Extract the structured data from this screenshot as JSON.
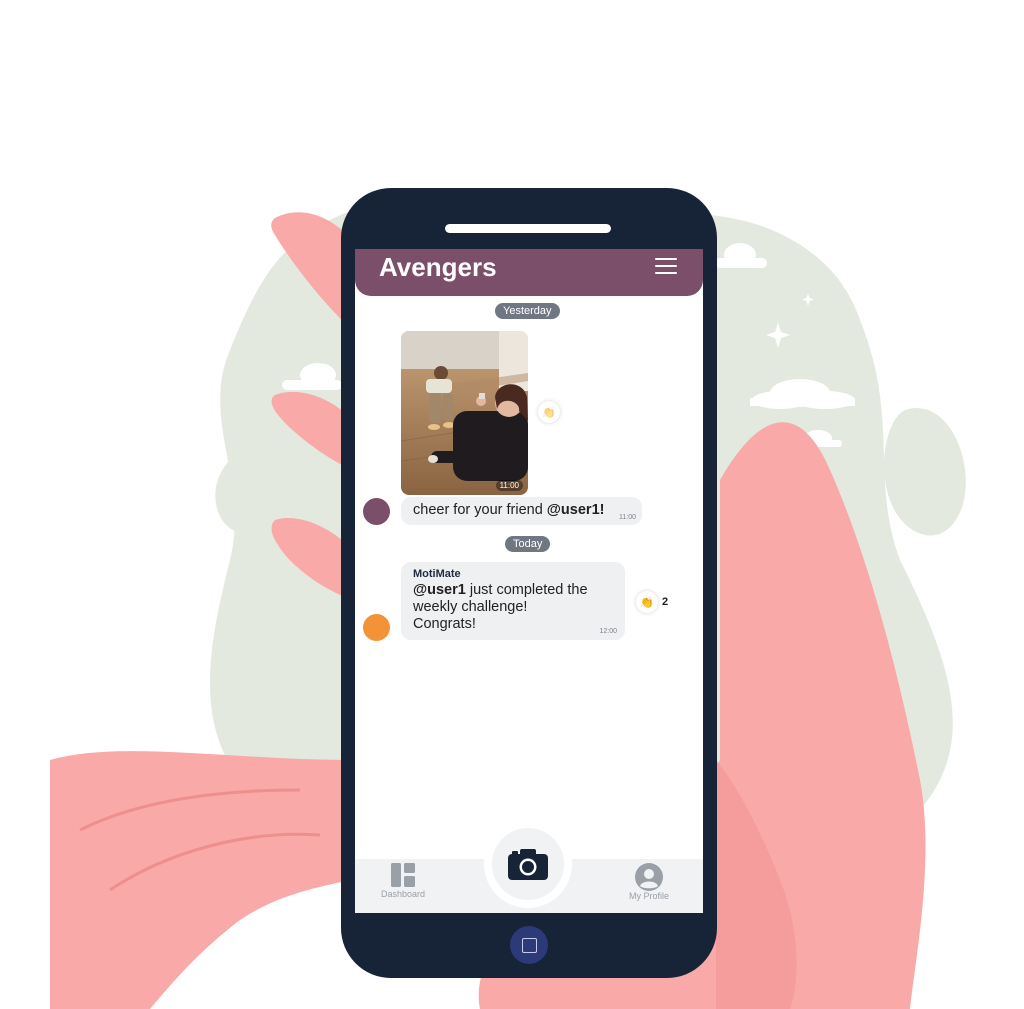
{
  "chat": {
    "title": "Avengers"
  },
  "dates": {
    "yesterday": "Yesterday",
    "today": "Today"
  },
  "messages": [
    {
      "photo_time": "11:00",
      "text_plain": "cheer for your friend ",
      "text_mention": "@user1!",
      "time": "11:00",
      "avatar_color": "#7b4f6a"
    },
    {
      "sender": "MotiMate",
      "mention": "@user1",
      "text_line1_rest": " just completed the",
      "text_line2": "weekly challenge!",
      "text_line3": "Congrats!",
      "time": "12:00",
      "avatar_color": "#f39237",
      "reaction_count": "2"
    }
  ],
  "nav": {
    "dashboard_label": "Dashboard",
    "profile_label": "My Profile"
  },
  "colors": {
    "header": "#7b4f6a",
    "phone_body": "#172336",
    "hand": "#f8a9a8",
    "blob": "#e3e9df"
  },
  "icons": {
    "menu": "hamburger-menu-icon",
    "reaction": "clapping-hands-icon",
    "dashboard": "dashboard-icon",
    "camera": "camera-icon",
    "profile": "profile-icon",
    "home": "home-button-icon"
  }
}
